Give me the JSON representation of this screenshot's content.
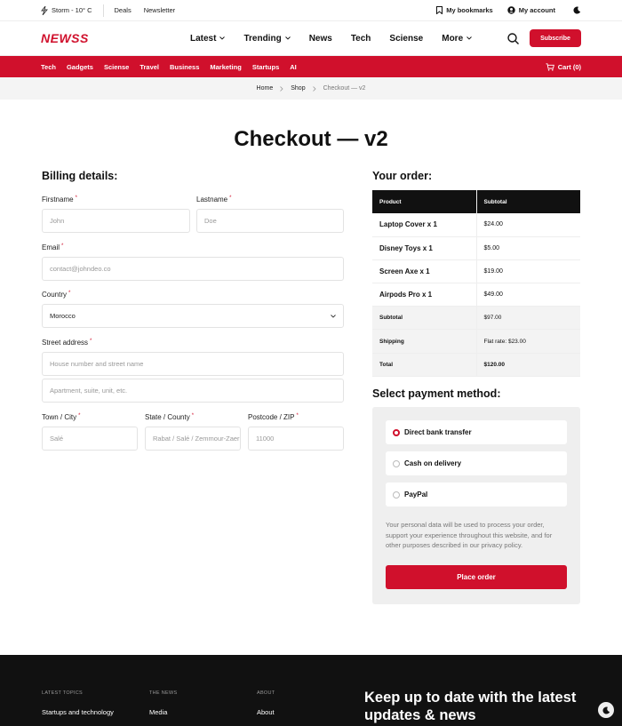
{
  "topbar": {
    "weather": "Storm - 10° C",
    "links": [
      "Deals",
      "Newsletter"
    ],
    "bookmarks": "My bookmarks",
    "account": "My account"
  },
  "nav": {
    "logo": "NEWSS",
    "items": [
      "Latest",
      "Trending",
      "News",
      "Tech",
      "Sciense",
      "More"
    ],
    "subscribe": "Subscribe"
  },
  "categories": [
    "Tech",
    "Gadgets",
    "Sciense",
    "Travel",
    "Business",
    "Marketing",
    "Startups",
    "AI"
  ],
  "cart": "Cart (0)",
  "breadcrumb": [
    "Home",
    "Shop",
    "Checkout — v2"
  ],
  "page_title": "Checkout — v2",
  "billing": {
    "heading": "Billing details:",
    "firstname_label": "Firstname",
    "firstname_ph": "John",
    "lastname_label": "Lastname",
    "lastname_ph": "Doe",
    "email_label": "Email",
    "email_ph": "contact@johndeo.co",
    "country_label": "Country",
    "country_value": "Morocco",
    "street_label": "Street address",
    "street_ph": "House number and street name",
    "apt_ph": "Apartment, suite, unit, etc.",
    "city_label": "Town / City",
    "city_ph": "Salé",
    "state_label": "State / County",
    "state_ph": "Rabat / Salé / Zemmour-Zaer",
    "zip_label": "Postcode / ZIP",
    "zip_ph": "11000"
  },
  "order": {
    "heading": "Your order:",
    "col_product": "Product",
    "col_subtotal": "Subtotal",
    "items": [
      {
        "name": "Laptop Cover x 1",
        "price": "$24.00"
      },
      {
        "name": "Disney Toys x 1",
        "price": "$5.00"
      },
      {
        "name": "Screen Axe x 1",
        "price": "$19.00"
      },
      {
        "name": "Airpods Pro x 1",
        "price": "$49.00"
      }
    ],
    "subtotal_label": "Subtotal",
    "subtotal_value": "$97.00",
    "shipping_label": "Shipping",
    "shipping_value": "Flat rate: $23.00",
    "total_label": "Total",
    "total_value": "$120.00"
  },
  "payment": {
    "heading": "Select payment method:",
    "options": [
      "Direct bank transfer",
      "Cash on delivery",
      "PayPal"
    ],
    "note": "Your personal data will be used to process your order, support your experience throughout this website, and for other purposes described in our privacy policy.",
    "button": "Place order"
  },
  "footer": {
    "col1_title": "LATEST TOPICS",
    "col1_link": "Startups and technology",
    "col2_title": "THE NEWS",
    "col2_link": "Media",
    "col3_title": "ABOUT",
    "col3_link": "About",
    "headline": "Keep up to date with the latest updates & news"
  },
  "colors": {
    "accent": "#d0102c",
    "footer_bg": "#111111"
  }
}
